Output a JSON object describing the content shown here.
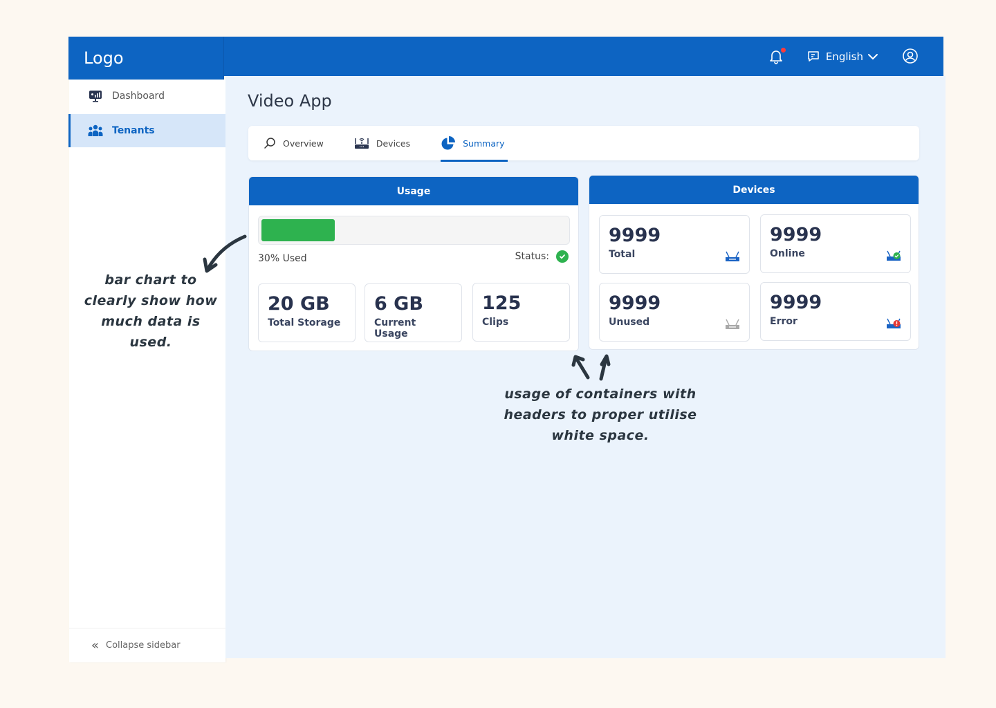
{
  "header": {
    "logo": "Logo",
    "language": "English",
    "icons": [
      "bell-icon",
      "chat-icon",
      "chevron-down-icon",
      "user-icon"
    ],
    "notification_dot_color": "#ff3b3b"
  },
  "sidebar": {
    "items": [
      {
        "label": "Dashboard",
        "icon": "dashboard-monitor-icon",
        "active": false
      },
      {
        "label": "Tenants",
        "icon": "users-group-icon",
        "active": true
      }
    ],
    "collapse_label": "Collapse sidebar"
  },
  "main": {
    "title": "Video App",
    "tabs": [
      {
        "label": "Overview",
        "icon": "search-icon",
        "active": false
      },
      {
        "label": "Devices",
        "icon": "router-icon",
        "active": false
      },
      {
        "label": "Summary",
        "icon": "pie-chart-icon",
        "active": true
      }
    ],
    "usage": {
      "header": "Usage",
      "percent_used": 30,
      "used_label": "30% Used",
      "status_label": "Status:",
      "status": "ok",
      "stats": [
        {
          "value": "20 GB",
          "label": "Total Storage"
        },
        {
          "value": "6 GB",
          "label": "Current Usage"
        },
        {
          "value": "125",
          "label": "Clips"
        }
      ]
    },
    "devices": {
      "header": "Devices",
      "stats": [
        {
          "value": "9999",
          "label": "Total",
          "icon": "router-icon"
        },
        {
          "value": "9999",
          "label": "Online",
          "icon": "router-online-icon"
        },
        {
          "value": "9999",
          "label": "Unused",
          "icon": "router-unused-icon"
        },
        {
          "value": "9999",
          "label": "Error",
          "icon": "router-error-icon"
        }
      ]
    }
  },
  "colors": {
    "primary": "#0d64c2",
    "success": "#2eb24f",
    "error": "#e53935",
    "background": "#ebf3fc"
  },
  "annotations": [
    "bar chart to clearly show how much data is used.",
    "usage of containers with headers to proper utilise white space."
  ]
}
